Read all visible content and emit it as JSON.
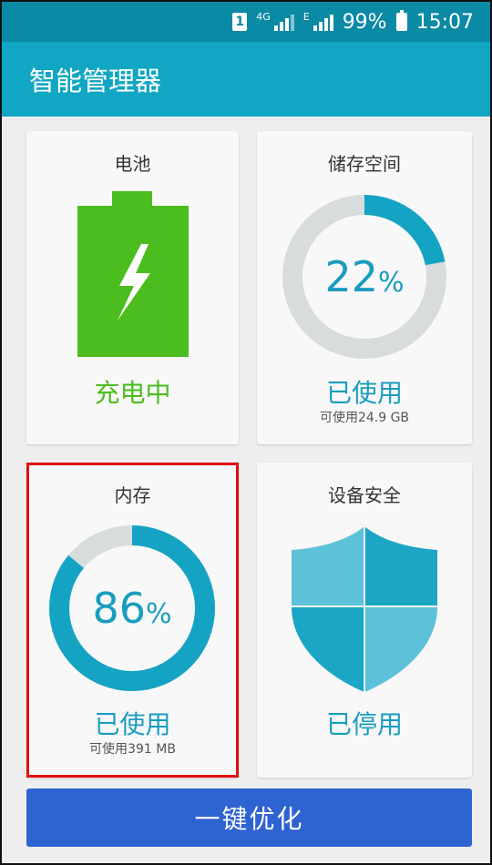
{
  "status_bar": {
    "sim_slot": "1",
    "network_4g": "4G",
    "network_e": "E",
    "battery_percent": "99%",
    "time": "15:07"
  },
  "app_bar": {
    "title": "智能管理器"
  },
  "cards": {
    "battery": {
      "title": "电池",
      "status": "充电中",
      "icon": "battery-charging-icon",
      "color": "#4cbd1f"
    },
    "storage": {
      "title": "储存空间",
      "percent_value": "22",
      "percent_sign": "%",
      "used_fraction": 0.22,
      "label": "已使用",
      "available": "可使用24.9 GB"
    },
    "memory": {
      "title": "内存",
      "percent_value": "86",
      "percent_sign": "%",
      "used_fraction": 0.86,
      "label": "已使用",
      "available": "可使用391 MB"
    },
    "security": {
      "title": "设备安全",
      "status": "已停用",
      "icon": "shield-icon"
    }
  },
  "optimize_button": {
    "label": "一键优化"
  },
  "colors": {
    "accent": "#10a6c4",
    "ring_used": "#15a3c3",
    "ring_free": "#d8dcdd",
    "button": "#2e63d2",
    "highlight": "#e11010"
  }
}
